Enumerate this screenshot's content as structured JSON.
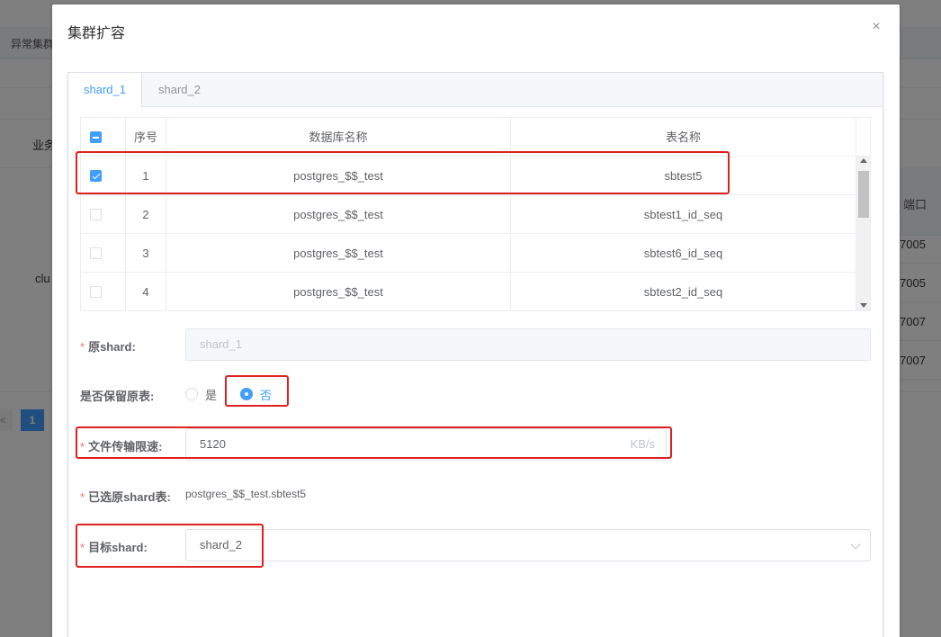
{
  "background": {
    "tab_label": "异常集群",
    "business_label": "业务",
    "cluster_label": "clu",
    "port_header": "端口",
    "ports": [
      "7005",
      "7005",
      "7007",
      "7007"
    ],
    "page_current": "1",
    "page_prev": "<"
  },
  "dialog": {
    "title": "集群扩容",
    "close": "×"
  },
  "tabs": [
    {
      "label": "shard_1",
      "active": true
    },
    {
      "label": "shard_2",
      "active": false
    }
  ],
  "table": {
    "columns": [
      "序号",
      "数据库名称",
      "表名称"
    ],
    "rows": [
      {
        "index": "1",
        "db": "postgres_$$_test",
        "table": "sbtest5",
        "checked": true
      },
      {
        "index": "2",
        "db": "postgres_$$_test",
        "table": "sbtest1_id_seq",
        "checked": false
      },
      {
        "index": "3",
        "db": "postgres_$$_test",
        "table": "sbtest6_id_seq",
        "checked": false
      },
      {
        "index": "4",
        "db": "postgres_$$_test",
        "table": "sbtest2_id_seq",
        "checked": false
      }
    ]
  },
  "form": {
    "source_shard": {
      "label": "原shard:",
      "value": "shard_1"
    },
    "keep_table": {
      "label": "是否保留原表:",
      "options": [
        "是",
        "否"
      ],
      "selected": "否"
    },
    "rate_limit": {
      "label": "文件传输限速:",
      "value": "5120",
      "unit": "KB/s"
    },
    "selected_table": {
      "label": "已选原shard表:",
      "value": "postgres_$$_test.sbtest5"
    },
    "target_shard": {
      "label": "目标shard:",
      "value": "shard_2"
    }
  },
  "colors": {
    "accent": "#409eff",
    "highlight": "#e02020",
    "required": "#f56c6c"
  }
}
